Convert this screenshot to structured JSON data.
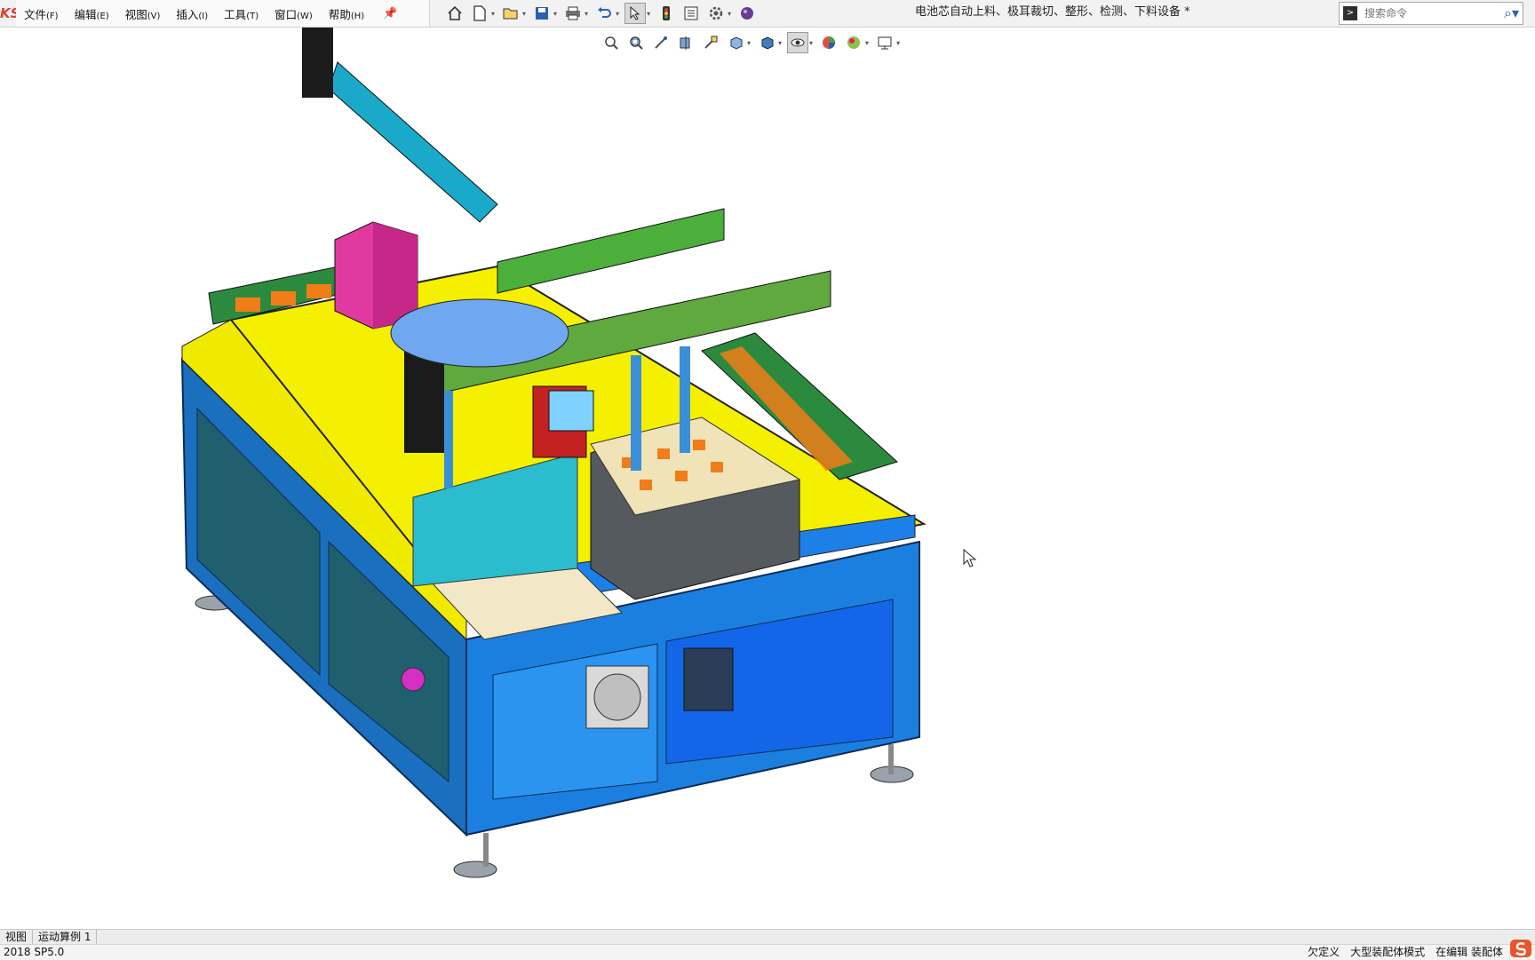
{
  "app": {
    "logo_text": "KS",
    "title": "电池芯自动上料、极耳裁切、整形、检测、下料设备 *"
  },
  "menu": {
    "items": [
      {
        "label": "文件",
        "accel": "(F)"
      },
      {
        "label": "编辑",
        "accel": "(E)"
      },
      {
        "label": "视图",
        "accel": "(V)"
      },
      {
        "label": "插入",
        "accel": "(I)"
      },
      {
        "label": "工具",
        "accel": "(T)"
      },
      {
        "label": "窗口",
        "accel": "(W)"
      },
      {
        "label": "帮助",
        "accel": "(H)"
      }
    ]
  },
  "search": {
    "placeholder": "搜索命令"
  },
  "toolbar": {
    "main_icons": [
      "home-icon",
      "new-document-icon",
      "open-folder-icon",
      "save-icon",
      "print-icon",
      "undo-icon",
      "select-pointer-icon",
      "traffic-light-icon",
      "options-list-icon",
      "settings-gear-icon",
      "appearance-sphere-icon"
    ],
    "view_icons": [
      "zoom-to-fit-icon",
      "zoom-area-icon",
      "previous-view-icon",
      "section-view-icon",
      "dynamic-annotation-icon",
      "view-orientation-icon",
      "display-style-icon",
      "hide-show-items-icon",
      "edit-appearance-icon",
      "apply-scene-icon",
      "view-settings-icon"
    ]
  },
  "tabs": [
    {
      "label": "视图"
    },
    {
      "label": "运动算例 1"
    }
  ],
  "status": {
    "version": "2018 SP5.0",
    "items": [
      "欠定义",
      "大型装配体模式",
      "在编辑 装配体"
    ]
  },
  "colors": {
    "accent": "#2b5fb3",
    "logo": "#d8432c",
    "machine_frame": "#1f6fd0",
    "table_top": "#f5f000"
  }
}
